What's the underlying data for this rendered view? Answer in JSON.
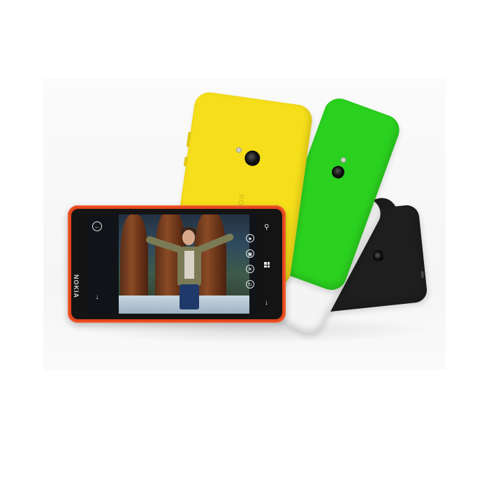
{
  "product": {
    "brand_front": "NOKIA",
    "brand_back": "NOKIA",
    "back_colors": {
      "yellow": "#f6df1a",
      "green": "#2bd11f",
      "white": "#f4f4f4",
      "black": "#1c1c1c"
    },
    "front_color": "#e2461c",
    "icons": [
      "camera-lens-icon",
      "flash-icon",
      "back-arrow-icon",
      "search-icon",
      "windows-start-icon",
      "camera-mode-icons"
    ]
  }
}
